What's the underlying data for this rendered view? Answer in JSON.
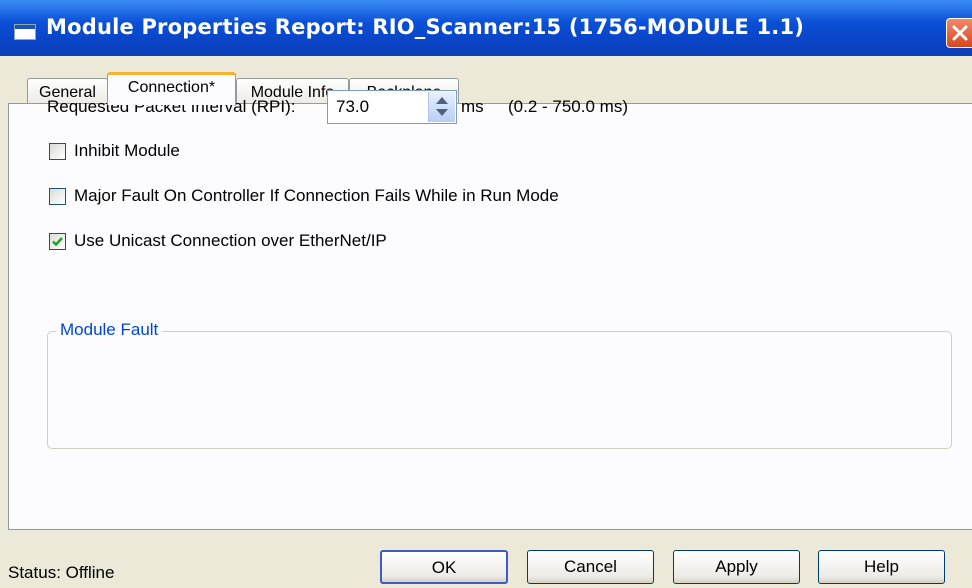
{
  "window": {
    "title": "Module Properties Report: RIO_Scanner:15 (1756-MODULE 1.1)",
    "close_icon": "close-icon"
  },
  "tabs": [
    {
      "label": "General",
      "active": false
    },
    {
      "label": "Connection*",
      "active": true
    },
    {
      "label": "Module Info",
      "active": false
    },
    {
      "label": "Backplane",
      "active": false
    }
  ],
  "connection": {
    "rpi_label": "Requested Packet Interval (RPI):",
    "rpi_value": "73.0",
    "rpi_unit": "ms",
    "rpi_range": "(0.2 - 750.0 ms)",
    "inhibit_label": "Inhibit Module",
    "inhibit_checked": false,
    "major_fault_label": "Major Fault On Controller If Connection Fails While in Run Mode",
    "major_fault_checked": false,
    "unicast_label": "Use Unicast Connection over EtherNet/IP",
    "unicast_checked": true,
    "module_fault_title": "Module Fault"
  },
  "footer": {
    "status": "Status:  Offline",
    "ok_label": "OK",
    "cancel_label": "Cancel",
    "apply_label": "Apply",
    "help_label": "Help"
  },
  "colors": {
    "titlebar": "#0a4fd6",
    "dialog_bg": "#ece9d8",
    "panel_bg": "#fcfcfe",
    "group_title": "#0046d5",
    "active_tab_accent": "#f8b030",
    "check_mark": "#21a121"
  }
}
